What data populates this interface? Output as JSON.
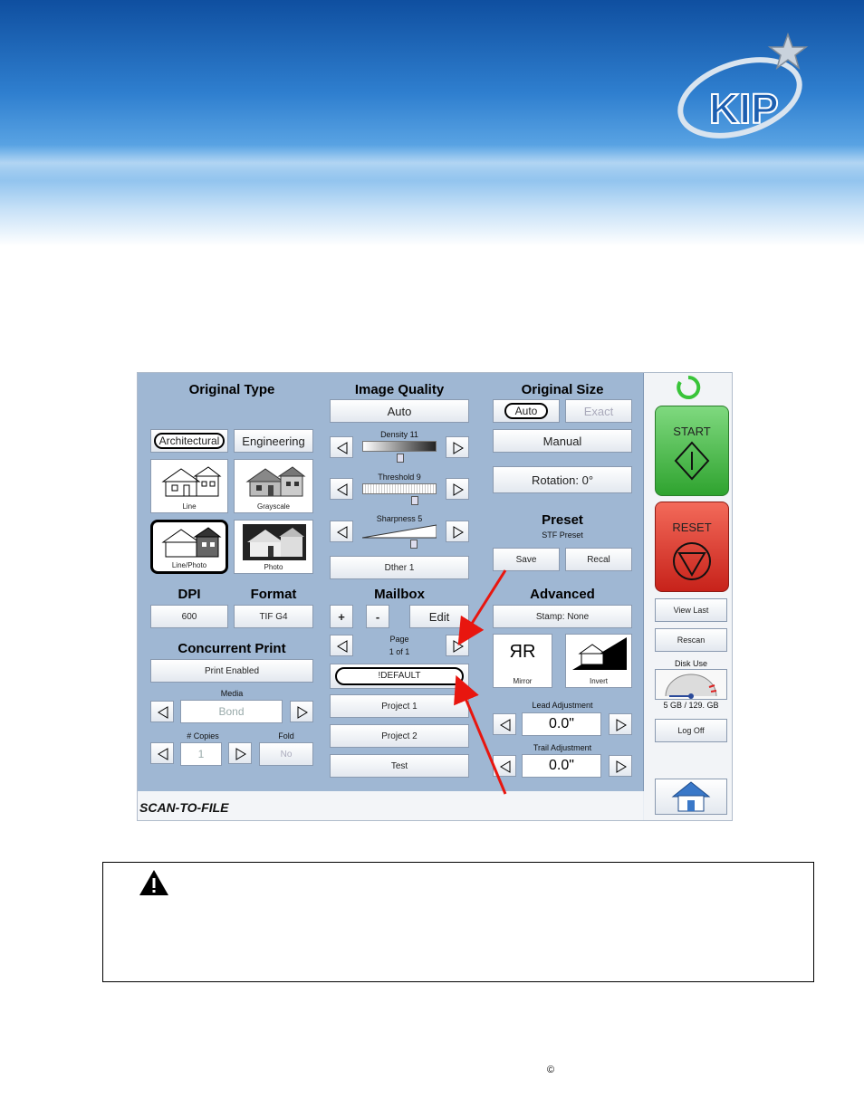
{
  "screenshot": {
    "status_label": "SCAN-TO-FILE",
    "original_type": {
      "title": "Original Type",
      "architectural": "Architectural",
      "engineering": "Engineering",
      "thumbs": [
        "Line",
        "Grayscale",
        "Line/Photo",
        "Photo"
      ]
    },
    "dpi": {
      "title": "DPI",
      "value": "600"
    },
    "format": {
      "title": "Format",
      "value": "TIF G4"
    },
    "concurrent_print": {
      "title": "Concurrent Print",
      "button": "Print Enabled",
      "media_label": "Media",
      "media_value": "Bond",
      "copies_label": "# Copies",
      "copies_value": "1",
      "fold_label": "Fold",
      "fold_value": "No"
    },
    "image_quality": {
      "title": "Image Quality",
      "auto": "Auto",
      "density": "Density 11",
      "density_level": 0.5,
      "threshold": "Threshold 9",
      "threshold_level": 0.72,
      "sharpness": "Sharpness 5",
      "sharpness_level": 0.72,
      "dither": "Dther 1"
    },
    "mailbox": {
      "title": "Mailbox",
      "plus": "+",
      "minus": "-",
      "edit": "Edit",
      "page_label": "Page",
      "page_value": "1 of 1",
      "items": [
        "!DEFAULT",
        "Project 1",
        "Project 2",
        "Test"
      ]
    },
    "original_size": {
      "title": "Original Size",
      "auto": "Auto",
      "exact": "Exact",
      "manual": "Manual",
      "rotation": "Rotation: 0°"
    },
    "preset": {
      "title": "Preset",
      "subtitle": "STF Preset",
      "save": "Save",
      "recall": "Recal"
    },
    "advanced": {
      "title": "Advanced",
      "stamp": "Stamp: None",
      "mirror": "Mirror",
      "mirror_glyph": "ЯR",
      "invert": "Invert",
      "lead_label": "Lead Adjustment",
      "lead_value": "0.0\"",
      "trail_label": "Trail Adjustment",
      "trail_value": "0.0\""
    },
    "side": {
      "start": "START",
      "reset": "RESET",
      "view_last": "View Last",
      "rescan": "Rescan",
      "disk_use_label": "Disk Use",
      "disk_use_value": "5 GB / 129. GB",
      "log_off": "Log Off"
    }
  },
  "logo_text": "KIP",
  "footer": {
    "copyright": "©"
  },
  "colors": {
    "accent_arrow": "#e8160f",
    "panel": "#9fb7d3",
    "start": "#2fa32f",
    "reset": "#c7221a"
  }
}
